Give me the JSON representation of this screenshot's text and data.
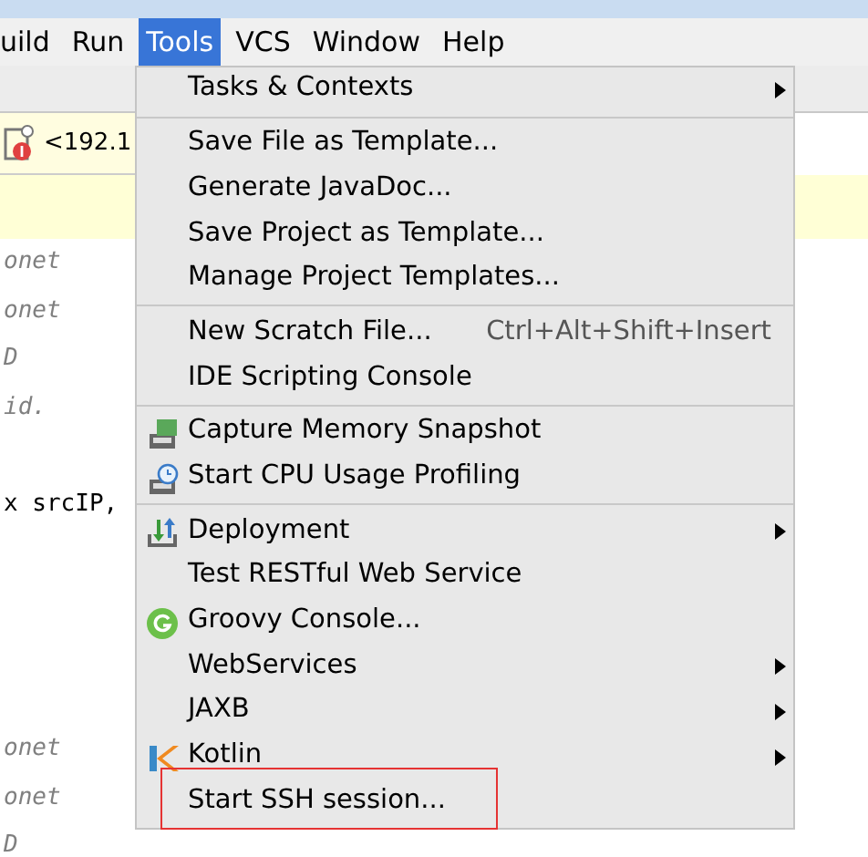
{
  "menu_bar": [
    {
      "label": "uild",
      "selected": false
    },
    {
      "label": "Run",
      "selected": false
    },
    {
      "label": "Tools",
      "selected": true
    },
    {
      "label": "VCS",
      "selected": false
    },
    {
      "label": "Window",
      "selected": false
    },
    {
      "label": "Help",
      "selected": false
    }
  ],
  "editor_tab": {
    "label": "<192.1"
  },
  "code_blocks": [
    [
      "onet",
      "onet",
      "D",
      "id."
    ],
    [
      "x srcIP,"
    ],
    [
      "onet",
      "onet",
      "D"
    ]
  ],
  "menu": [
    {
      "kind": "item",
      "label": "Tasks & Contexts",
      "submenu": true
    },
    {
      "kind": "separator"
    },
    {
      "kind": "item",
      "label": "Save File as Template..."
    },
    {
      "kind": "item",
      "label": "Generate JavaDoc..."
    },
    {
      "kind": "item",
      "label": "Save Project as Template..."
    },
    {
      "kind": "item",
      "label": "Manage Project Templates..."
    },
    {
      "kind": "separator"
    },
    {
      "kind": "item",
      "label": "New Scratch File...",
      "shortcut": "Ctrl+Alt+Shift+Insert"
    },
    {
      "kind": "item",
      "label": "IDE Scripting Console"
    },
    {
      "kind": "separator"
    },
    {
      "kind": "item",
      "label": "Capture Memory Snapshot"
    },
    {
      "kind": "item",
      "label": "Start CPU Usage Profiling"
    },
    {
      "kind": "separator"
    },
    {
      "kind": "item",
      "label": "Deployment",
      "submenu": true
    },
    {
      "kind": "item",
      "label": "Test RESTful Web Service"
    },
    {
      "kind": "item",
      "label": "Groovy Console..."
    },
    {
      "kind": "item",
      "label": "WebServices",
      "submenu": true
    },
    {
      "kind": "item",
      "label": "JAXB",
      "submenu": true
    },
    {
      "kind": "item",
      "label": "Kotlin",
      "submenu": true
    },
    {
      "kind": "item",
      "label": "Start SSH session...",
      "highlighted": true
    }
  ]
}
